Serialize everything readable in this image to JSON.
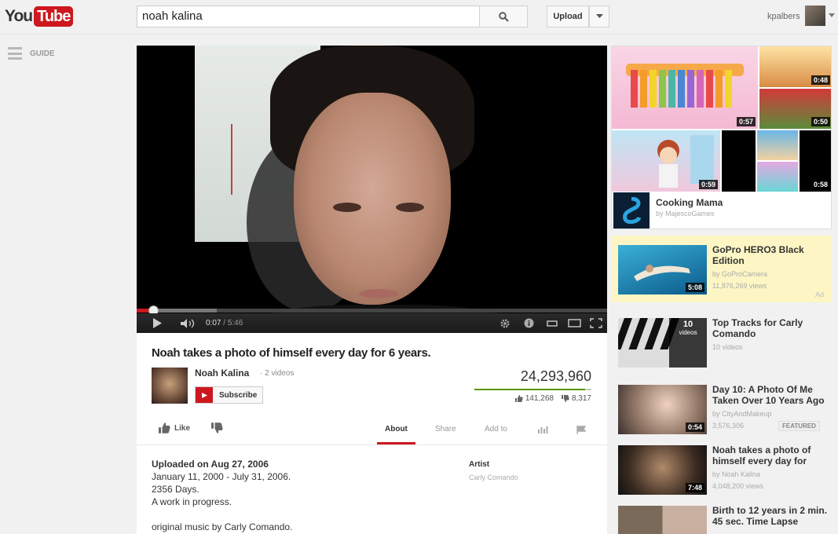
{
  "header": {
    "logo_you": "You",
    "logo_tube": "Tube",
    "search_query": "noah kalina",
    "upload_label": "Upload",
    "username": "kpalbers"
  },
  "guide": {
    "label": "GUIDE"
  },
  "player": {
    "current_time": "0:07",
    "duration": "5:46",
    "progress_played_fraction": 0.035,
    "progress_buffered_fraction": 0.17
  },
  "video": {
    "title": "Noah takes a photo of himself every day for 6 years.",
    "channel_name": "Noah Kalina",
    "channel_videos": "2 videos",
    "subscribe_label": "Subscribe",
    "view_count": "24,293,960",
    "likes": "141,268",
    "dislikes": "8,317",
    "like_fraction": 0.944,
    "like_label": "Like",
    "tabs": [
      "About",
      "Share",
      "Add to"
    ],
    "active_tab": "About",
    "upload_date": "Uploaded on Aug 27, 2006",
    "description_lines": [
      "January 11, 2000 - July 31, 2006.",
      "2356 Days.",
      "A work in progress.",
      "",
      "original music by Carly Comando."
    ],
    "meta_label": "Artist",
    "meta_value": "Carly Comando"
  },
  "sidebar": {
    "top_ad": {
      "title": "Cooking Mama",
      "by": "by MajescoGames",
      "tile_durations": [
        "0:48",
        "0:57",
        "0:50",
        "0:59",
        "0:58"
      ]
    },
    "items": [
      {
        "title": "GoPro HERO3 Black Edition",
        "by": "by GoProCamera",
        "views": "11,876,269 views",
        "duration": "5:08",
        "ad_label": "Ad",
        "promo": true
      },
      {
        "title": "Top Tracks for Carly Comando",
        "by": "10 videos",
        "playlist_count": "10",
        "playlist_sub": "videos"
      },
      {
        "title": "Day 10: A Photo Of Me Taken Over 10 Years Ago",
        "by": "by CityAndMakeup",
        "views": "3,576,306",
        "duration": "0:54",
        "badge": "FEATURED"
      },
      {
        "title": "Noah takes a photo of himself every day for",
        "by": "by Noah Kalina",
        "views": "4,048,200 views",
        "duration": "7:48"
      },
      {
        "title": "Birth to 12 years in 2 min. 45 sec. Time Lapse"
      }
    ]
  },
  "colors": {
    "brand_red": "#cc181e",
    "like_green": "#559900",
    "promo_yellow": "#fdf6c4"
  }
}
